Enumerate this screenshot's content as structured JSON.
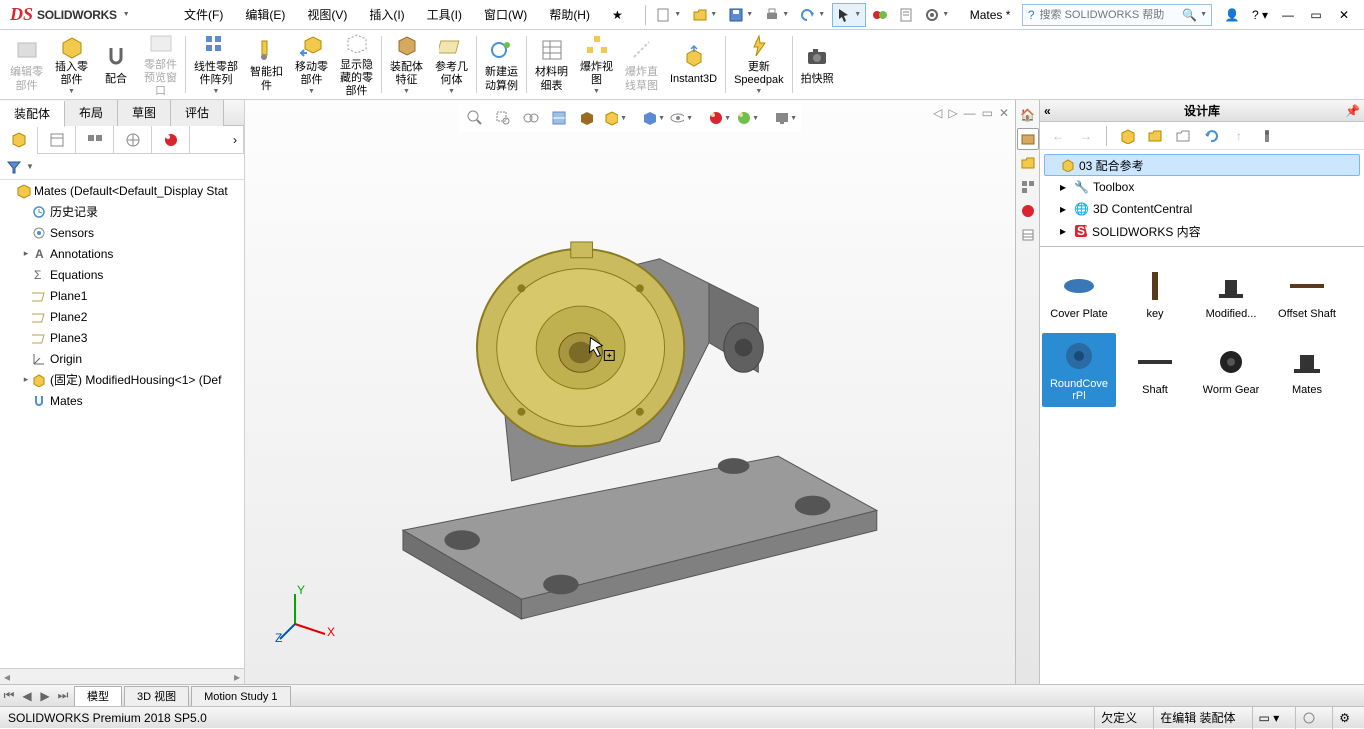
{
  "app": {
    "logo_prefix": "DS",
    "logo_name": "SOLIDWORKS"
  },
  "menubar": {
    "file": "文件(F)",
    "edit": "编辑(E)",
    "view": "视图(V)",
    "insert": "插入(I)",
    "tools": "工具(I)",
    "window": "窗口(W)",
    "help": "帮助(H)"
  },
  "doc_title": "Mates *",
  "search": {
    "placeholder": "搜索 SOLIDWORKS 帮助"
  },
  "ribbon": {
    "edit_part": "编辑零\n部件",
    "insert_part": "插入零\n部件",
    "mate": "配合",
    "part_preview_window": "零部件\n预览窗\n口",
    "linear_pattern": "线性零部\n件阵列",
    "smart_snap": "智能扣\n件",
    "move_part": "移动零\n部件",
    "show_hidden": "显示隐\n藏的零\n部件",
    "assembly_feature": "装配体\n特征",
    "ref_geom": "参考几\n何体",
    "new_motion": "新建运\n动算例",
    "bom": "材料明\n细表",
    "explode": "爆炸视\n图",
    "explode_line": "爆炸直\n线草图",
    "instant3d": "Instant3D",
    "update_speedpak": "更新\nSpeedpak",
    "snapshot": "拍快照"
  },
  "tabs": {
    "assembly": "装配体",
    "layout": "布局",
    "sketch": "草图",
    "evaluate": "评估"
  },
  "tree": {
    "root": "Mates  (Default<Default_Display Stat",
    "history": "历史记录",
    "sensors": "Sensors",
    "annotations": "Annotations",
    "equations": "Equations",
    "plane1": "Plane1",
    "plane2": "Plane2",
    "plane3": "Plane3",
    "origin": "Origin",
    "mod_housing": "(固定) ModifiedHousing<1> (Def",
    "mates": "Mates"
  },
  "designlib": {
    "title": "设计库",
    "items": {
      "ref": "03 配合参考",
      "toolbox": "Toolbox",
      "content_central": "3D ContentCentral",
      "sw_content": "SOLIDWORKS 内容"
    }
  },
  "gallery": {
    "cover_plate": "Cover Plate",
    "key": "key",
    "modified": "Modified...",
    "offset_shaft": "Offset Shaft",
    "roundcover": "RoundCove\nrPl",
    "shaft": "Shaft",
    "worm_gear": "Worm Gear",
    "mates_g": "Mates"
  },
  "bottom_tabs": {
    "model": "模型",
    "view3d": "3D 视图",
    "motion": "Motion Study 1"
  },
  "status": {
    "left": "SOLIDWORKS Premium 2018 SP5.0",
    "underdefined": "欠定义",
    "editing": "在编辑 装配体"
  }
}
